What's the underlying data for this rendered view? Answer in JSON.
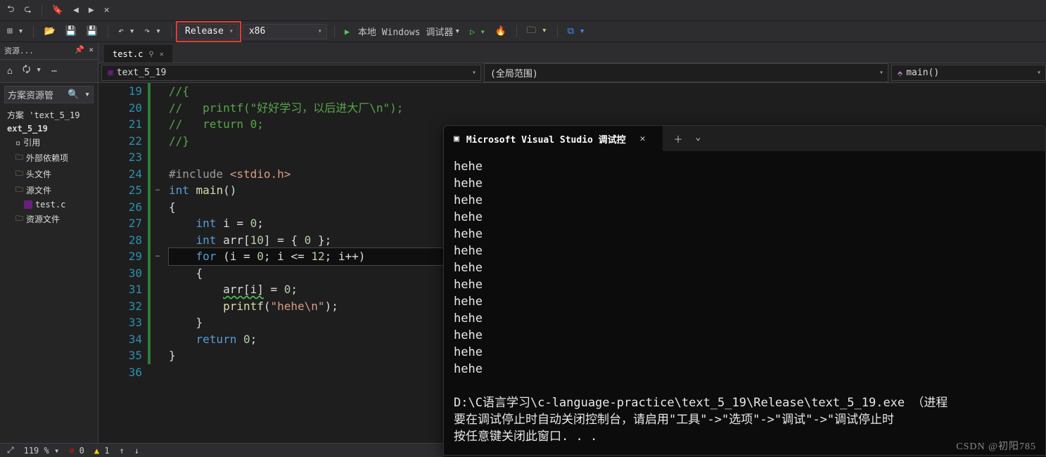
{
  "toolbar": {
    "config": "Release",
    "platform": "x86",
    "debug_label": "本地 Windows 调试器"
  },
  "sidepanel": {
    "title": "资源...",
    "search_placeholder": "方案资源管",
    "solution": "方案 'text_5_19",
    "project": "ext_5_19",
    "refs": "引用",
    "ext_deps": "外部依赖项",
    "headers": "头文件",
    "sources": "源文件",
    "source_file": "test.c",
    "resources": "资源文件"
  },
  "tab": {
    "name": "test.c"
  },
  "navbar": {
    "scope_file": "text_5_19",
    "scope_global": "(全局范围)",
    "scope_func": "main()"
  },
  "code": {
    "lines": [
      {
        "n": 19,
        "mod": true,
        "html": "<span class='c-comment'>//{</span>"
      },
      {
        "n": 20,
        "mod": true,
        "html": "<span class='c-comment'>//   printf(\"好好学习，以后进大厂\\n\");</span>"
      },
      {
        "n": 21,
        "mod": true,
        "html": "<span class='c-comment'>//   return 0;</span>"
      },
      {
        "n": 22,
        "mod": true,
        "html": "<span class='c-comment'>//}</span>"
      },
      {
        "n": 23,
        "mod": true,
        "html": ""
      },
      {
        "n": 24,
        "mod": true,
        "html": "<span class='c-pre'>#include</span> <span class='c-inc'>&lt;stdio.h&gt;</span>"
      },
      {
        "n": 25,
        "mod": true,
        "fold": "−",
        "html": "<span class='c-type'>int</span> <span class='c-func'>main</span>()"
      },
      {
        "n": 26,
        "mod": true,
        "html": "{"
      },
      {
        "n": 27,
        "mod": true,
        "html": "    <span class='c-type'>int</span> i = <span class='c-num'>0</span>;"
      },
      {
        "n": 28,
        "mod": true,
        "html": "    <span class='c-type'>int</span> arr[<span class='c-num'>10</span>] = { <span class='c-num'>0</span> };"
      },
      {
        "n": 29,
        "mod": true,
        "fold": "−",
        "hl": true,
        "html": "    <span class='c-keyword'>for</span> (i = <span class='c-num'>0</span>; i &lt;= <span class='c-num'>12</span>; i++)"
      },
      {
        "n": 30,
        "mod": true,
        "html": "    {"
      },
      {
        "n": 31,
        "mod": true,
        "html": "        <span class='c-squiggle'>arr[i]</span> = <span class='c-num'>0</span>;"
      },
      {
        "n": 32,
        "mod": true,
        "html": "        <span class='c-func'>printf</span>(<span class='c-str'>\"hehe\\n\"</span>);"
      },
      {
        "n": 33,
        "mod": true,
        "html": "    }"
      },
      {
        "n": 34,
        "mod": true,
        "html": "    <span class='c-keyword'>return</span> <span class='c-num'>0</span>;"
      },
      {
        "n": 35,
        "mod": true,
        "html": "}"
      },
      {
        "n": 36,
        "mod": false,
        "html": ""
      }
    ]
  },
  "console": {
    "title": "Microsoft Visual Studio 调试控",
    "lines": [
      "hehe",
      "hehe",
      "hehe",
      "hehe",
      "hehe",
      "hehe",
      "hehe",
      "hehe",
      "hehe",
      "hehe",
      "hehe",
      "hehe",
      "hehe"
    ],
    "tail1": "D:\\C语言学习\\c-language-practice\\text_5_19\\Release\\text_5_19.exe （进程",
    "tail2": "要在调试停止时自动关闭控制台，请启用\"工具\"->\"选项\"->\"调试\"->\"调试停止时",
    "tail3": "按任意键关闭此窗口. . ."
  },
  "status": {
    "zoom": "119 %",
    "errors": "0",
    "warnings": "1"
  },
  "watermark": "CSDN @初阳785"
}
